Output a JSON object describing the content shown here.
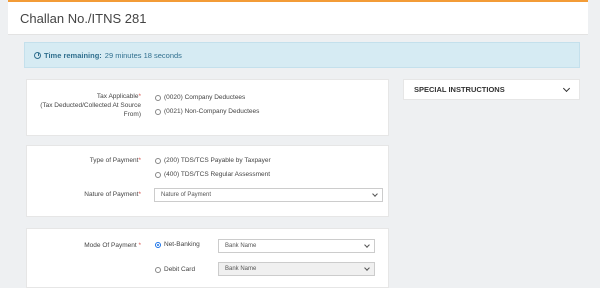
{
  "header": {
    "title": "Challan No./ITNS 281"
  },
  "timer": {
    "label": "Time remaining:",
    "value": "29 minutes 18 seconds"
  },
  "special_instructions": {
    "label": "SPECIAL INSTRUCTIONS"
  },
  "tax_applicable": {
    "label": "Tax Applicable",
    "sublabel": "(Tax Deducted/Collected At Source From)",
    "options": [
      "(0020) Company Deductees",
      "(0021) Non-Company Deductees"
    ]
  },
  "type_of_payment": {
    "label": "Type of Payment",
    "options": [
      "(200) TDS/TCS Payable by Taxpayer",
      "(400) TDS/TCS Regular Assessment"
    ]
  },
  "nature_of_payment": {
    "label": "Nature of Payment",
    "value": "Nature of Payment"
  },
  "mode_of_payment": {
    "label": "Mode Of Payment",
    "options": [
      {
        "label": "Net-Banking",
        "selected": true,
        "select_value": "Bank Name"
      },
      {
        "label": "Debit Card",
        "selected": false,
        "select_value": "Bank Name"
      }
    ]
  },
  "required_mark": "*",
  "colors": {
    "accent": "#f39c37",
    "info_bg": "#d6ebf3",
    "info_text": "#31708f",
    "radio_selected": "#1a73e8"
  }
}
